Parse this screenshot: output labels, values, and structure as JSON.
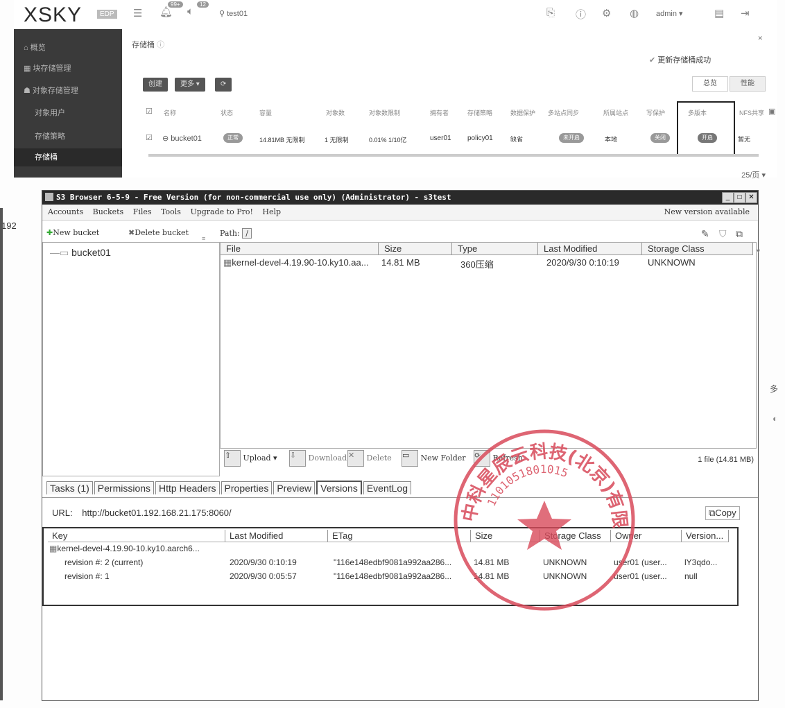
{
  "xsky": {
    "logo": "XSKY",
    "edition": "EDP",
    "header": {
      "notif_badge": "99+",
      "sound_badge": "12",
      "cluster": "test01",
      "user": "admin"
    },
    "sidebar": {
      "items": [
        {
          "label": "概览"
        },
        {
          "label": "块存储管理"
        },
        {
          "label": "对象存储管理"
        },
        {
          "label": "对象用户"
        },
        {
          "label": "存储策略"
        },
        {
          "label": "存储桶"
        }
      ]
    },
    "page_title": "存储桶",
    "toast": "更新存储桶成功",
    "toolbar": {
      "create": "创建",
      "more": "更多"
    },
    "view_tabs": {
      "overview": "总览",
      "performance": "性能"
    },
    "table": {
      "headers": [
        "名称",
        "状态",
        "容量",
        "对象数",
        "对象数限制",
        "拥有者",
        "存储策略",
        "数据保护",
        "多站点同步",
        "所属站点",
        "写保护",
        "多版本",
        "NFS共享"
      ],
      "row": {
        "name": "bucket01",
        "status": "正常",
        "size": "14.81MB 无限制",
        "objects": "1 无限制",
        "quota": "0.01% 1/10亿",
        "owner": "user01",
        "policy": "policy01",
        "protection": "缺省",
        "multisite": "未开启",
        "site": "本地",
        "write_protect": "关闭",
        "versioning": "开启",
        "nfs": "暂无"
      }
    },
    "pager": "25/页"
  },
  "s3": {
    "title": "S3 Browser 6-5-9 - Free Version (for non-commercial use only) (Administrator) - s3test",
    "menu": [
      "Accounts",
      "Buckets",
      "Files",
      "Tools",
      "Upgrade to Pro!",
      "Help"
    ],
    "new_version": "New version available",
    "new_bucket": "New bucket",
    "delete_bucket": "Delete bucket",
    "path_label": "Path:",
    "path_value": "/",
    "tree": [
      "bucket01"
    ],
    "file_columns": [
      "File",
      "Size",
      "Type",
      "Last Modified",
      "Storage Class"
    ],
    "files": [
      {
        "name": "kernel-devel-4.19.90-10.ky10.aa...",
        "size": "14.81 MB",
        "type": "360压缩",
        "modified": "2020/9/30 0:10:19",
        "storage_class": "UNKNOWN"
      }
    ],
    "file_toolbar": {
      "upload": "Upload",
      "download": "Download",
      "delete": "Delete",
      "new_folder": "New Folder",
      "refresh": "Refresh"
    },
    "file_count": "1 file (14.81 MB)",
    "tabs": [
      "Tasks (1)",
      "Permissions",
      "Http Headers",
      "Properties",
      "Preview",
      "Versions",
      "EventLog"
    ],
    "url_label": "URL:",
    "url_value": "http://bucket01.192.168.21.175:8060/",
    "copy": "Copy",
    "version_columns": [
      "Key",
      "Last Modified",
      "ETag",
      "Size",
      "Storage Class",
      "Owner",
      "Version..."
    ],
    "version_file": "kernel-devel-4.19.90-10.ky10.aarch6...",
    "revisions": [
      {
        "label": "revision #: 2 (current)",
        "modified": "2020/9/30 0:10:19",
        "etag": "\"116e148edbf9081a992aa286...",
        "size": "14.81 MB",
        "storage_class": "UNKNOWN",
        "owner": "user01 (user...",
        "version": "lY3qdo..."
      },
      {
        "label": "revision #: 1",
        "modified": "2020/9/30 0:05:57",
        "etag": "\"116e148edbf9081a992aa286...",
        "size": "14.81 MB",
        "storage_class": "UNKNOWN",
        "owner": "user01 (user...",
        "version": "null"
      }
    ]
  },
  "side_fragments": {
    "left": "192",
    "right": "多"
  },
  "stamp": {
    "number": "1101051801015",
    "company": "中科星辰云科技(北京)有限公司"
  }
}
